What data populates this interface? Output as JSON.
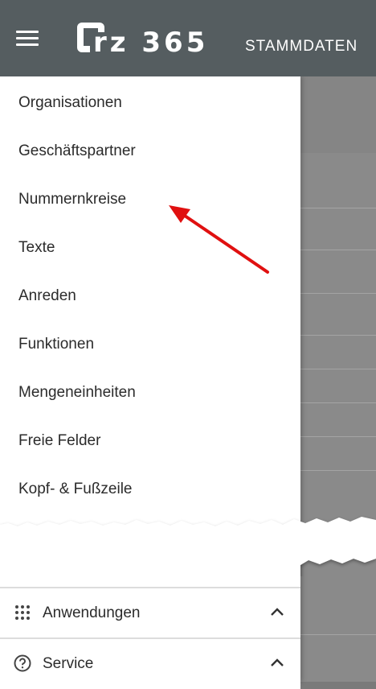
{
  "appbar": {
    "menu_icon": "hamburger-icon",
    "logo_text": "rz 365",
    "module_title": "STAMMDATEN"
  },
  "drawer": {
    "items": [
      {
        "label": "Organisationen"
      },
      {
        "label": "Geschäftspartner"
      },
      {
        "label": "Nummernkreise"
      },
      {
        "label": "Texte"
      },
      {
        "label": "Anreden"
      },
      {
        "label": "Funktionen"
      },
      {
        "label": "Mengeneinheiten"
      },
      {
        "label": "Freie Felder"
      },
      {
        "label": "Kopf- & Fußzeile"
      }
    ],
    "sections": [
      {
        "label": "Anwendungen",
        "icon": "apps-grid-icon",
        "chevron": "chevron-up-icon"
      },
      {
        "label": "Service",
        "icon": "help-circle-icon",
        "chevron": "chevron-up-icon"
      }
    ]
  },
  "annotation": {
    "arrow_color": "#e01010",
    "points_to": "Nummernkreise"
  },
  "colors": {
    "appbar": "#555d60",
    "text": "#2b2b2b",
    "overlay": "#8a8a8a"
  }
}
